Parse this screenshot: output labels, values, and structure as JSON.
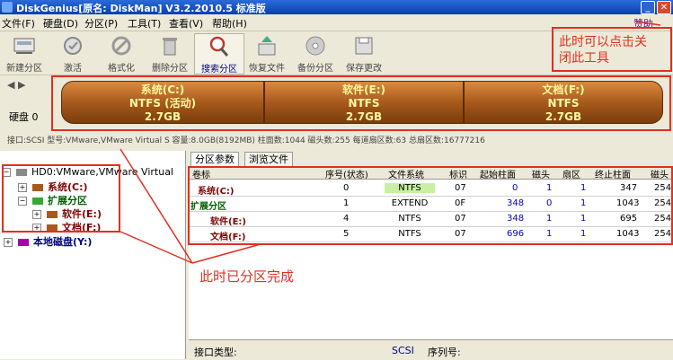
{
  "window": {
    "title": "DiskGenius[原名: DiskMan] V3.2.2010.5 标准版",
    "min_label": "_",
    "close_label": "✕"
  },
  "menu": [
    "文件(F)",
    "硬盘(D)",
    "分区(P)",
    "工具(T)",
    "查看(V)",
    "帮助(H)"
  ],
  "corner_label": "赞助",
  "toolbar": [
    {
      "label": "新建分区",
      "icon": "new-partition-icon"
    },
    {
      "label": "激活",
      "icon": "activate-icon"
    },
    {
      "label": "格式化",
      "icon": "format-icon"
    },
    {
      "label": "删除分区",
      "icon": "delete-partition-icon"
    },
    {
      "label": "搜索分区",
      "icon": "search-partition-icon",
      "active": true
    },
    {
      "label": "恢复文件",
      "icon": "recover-file-icon"
    },
    {
      "label": "备份分区",
      "icon": "backup-partition-icon"
    },
    {
      "label": "保存更改",
      "icon": "save-changes-icon"
    }
  ],
  "disk_nav": {
    "arrows": "◀ ▶",
    "label": "硬盘 0"
  },
  "partitions": [
    {
      "name": "系统(C:)",
      "fs": "NTFS (活动)",
      "size": "2.7GB"
    },
    {
      "name": "软件(E:)",
      "fs": "NTFS",
      "size": "2.7GB"
    },
    {
      "name": "文档(F:)",
      "fs": "NTFS",
      "size": "2.7GB"
    }
  ],
  "iface_line": "接口:SCSI  型号:VMware,VMware Virtual S  容量:8.0GB(8192MB)  柱面数:1044  磁头数:255  每道扇区数:63  总扇区数:16777216",
  "tree": {
    "disk": "HD0:VMware,VMware Virtual",
    "items": [
      "系统(C:)",
      "扩展分区",
      "软件(E:)",
      "文档(F:)"
    ],
    "local_disk": "本地磁盘(Y:)"
  },
  "tabs": [
    "分区参数",
    "浏览文件"
  ],
  "table": {
    "headers": [
      "卷标",
      "序号(状态)",
      "文件系统",
      "标识",
      "起始柱面",
      "磁头",
      "扇区",
      "终止柱面",
      "磁头"
    ],
    "rows": [
      {
        "label": "系统(C:)",
        "seq": "0",
        "fs": "NTFS",
        "id": "07",
        "start_cyl": "0",
        "head": "1",
        "sector": "1",
        "end_cyl": "347",
        "end_head": "254"
      },
      {
        "label": "扩展分区",
        "seq": "1",
        "fs": "EXTEND",
        "id": "0F",
        "start_cyl": "348",
        "head": "0",
        "sector": "1",
        "end_cyl": "1043",
        "end_head": "254"
      },
      {
        "label": "软件(E:)",
        "seq": "4",
        "fs": "NTFS",
        "id": "07",
        "start_cyl": "348",
        "head": "1",
        "sector": "1",
        "end_cyl": "695",
        "end_head": "254"
      },
      {
        "label": "文档(F:)",
        "seq": "5",
        "fs": "NTFS",
        "id": "07",
        "start_cyl": "696",
        "head": "1",
        "sector": "1",
        "end_cyl": "1043",
        "end_head": "254"
      }
    ]
  },
  "bottom": {
    "iface_label": "接口类型:",
    "iface_value": "SCSI",
    "serial_label": "序列号:"
  },
  "annotations": {
    "close_tool": "此时可以点击关\n闭此工具",
    "done": "此时已分区完成"
  },
  "colors": {
    "annotation": "#e03020",
    "partition_text": "#fff8a0",
    "titlebar": "#0a3fb3"
  }
}
